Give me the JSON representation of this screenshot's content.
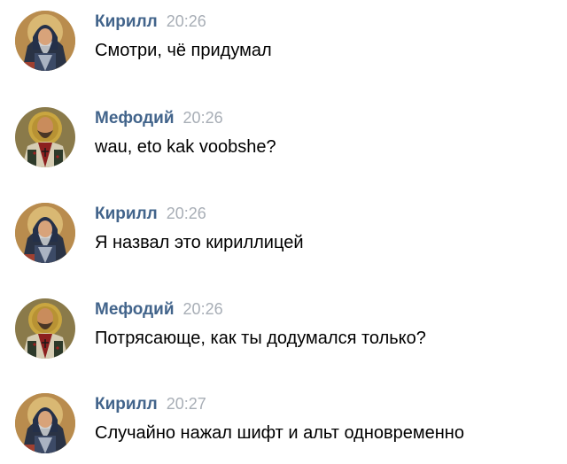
{
  "messages": [
    {
      "author": "Кирилл",
      "time": "20:26",
      "text": "Смотри, чё придумал",
      "avatar": "kirill-icon-avatar"
    },
    {
      "author": "Мефодий",
      "time": "20:26",
      "text": "wau, eto kak voobshe?",
      "avatar": "mefodiy-icon-avatar"
    },
    {
      "author": "Кирилл",
      "time": "20:26",
      "text": "Я назвал это кириллицей",
      "avatar": "kirill-icon-avatar"
    },
    {
      "author": "Мефодий",
      "time": "20:26",
      "text": "Потрясающе, как ты додумался только?",
      "avatar": "mefodiy-icon-avatar"
    },
    {
      "author": "Кирилл",
      "time": "20:27",
      "text": "Случайно нажал шифт и альт одновременно",
      "avatar": "kirill-icon-avatar"
    }
  ],
  "colors": {
    "author": "#42648b",
    "time": "#a8aeb6",
    "text": "#000000",
    "background": "#ffffff"
  }
}
